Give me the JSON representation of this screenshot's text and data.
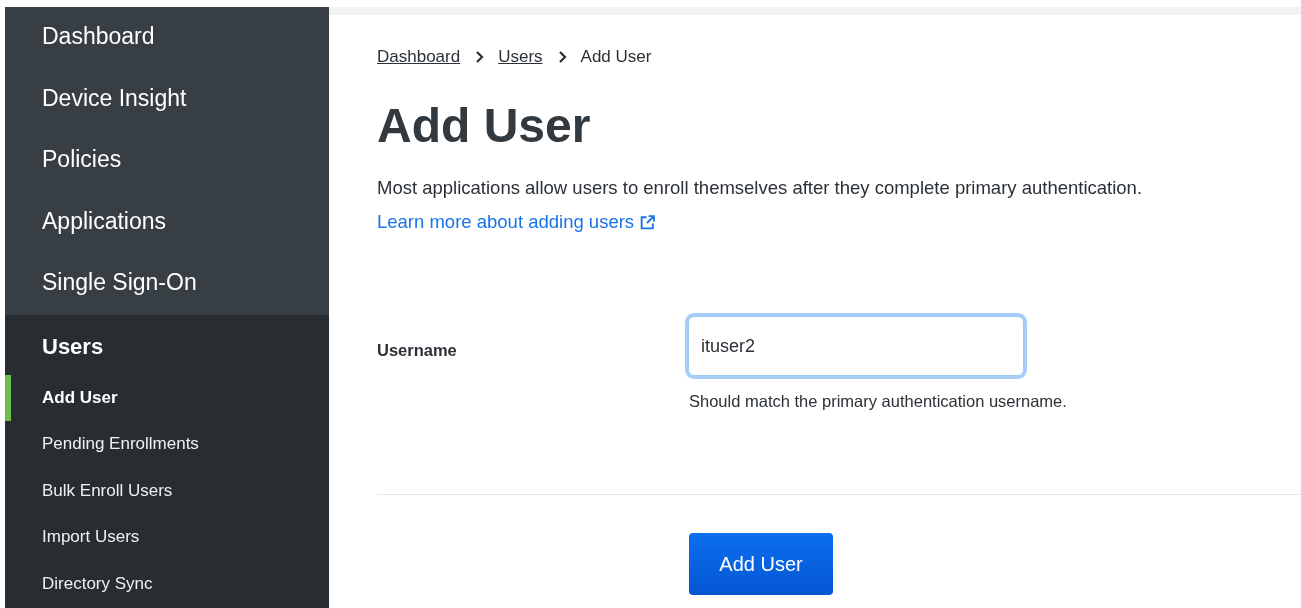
{
  "sidebar": {
    "items": [
      {
        "label": "Dashboard"
      },
      {
        "label": "Device Insight"
      },
      {
        "label": "Policies"
      },
      {
        "label": "Applications"
      },
      {
        "label": "Single Sign-On"
      },
      {
        "label": "Users",
        "expanded": true,
        "children": [
          {
            "label": "Add User",
            "selected": true
          },
          {
            "label": "Pending Enrollments",
            "selected": false
          },
          {
            "label": "Bulk Enroll Users",
            "selected": false
          },
          {
            "label": "Import Users",
            "selected": false
          },
          {
            "label": "Directory Sync",
            "selected": false
          }
        ]
      }
    ]
  },
  "breadcrumb": [
    {
      "label": "Dashboard",
      "link": true
    },
    {
      "label": "Users",
      "link": true
    },
    {
      "label": "Add User",
      "link": false
    }
  ],
  "title": "Add User",
  "description": "Most applications allow users to enroll themselves after they complete primary authentication.",
  "learn_more_link": "Learn more about adding users",
  "form": {
    "label": "Username",
    "value": "ituser2",
    "focused": true,
    "hint": "Should match the primary authentication username."
  },
  "submit_button": "Add User"
}
